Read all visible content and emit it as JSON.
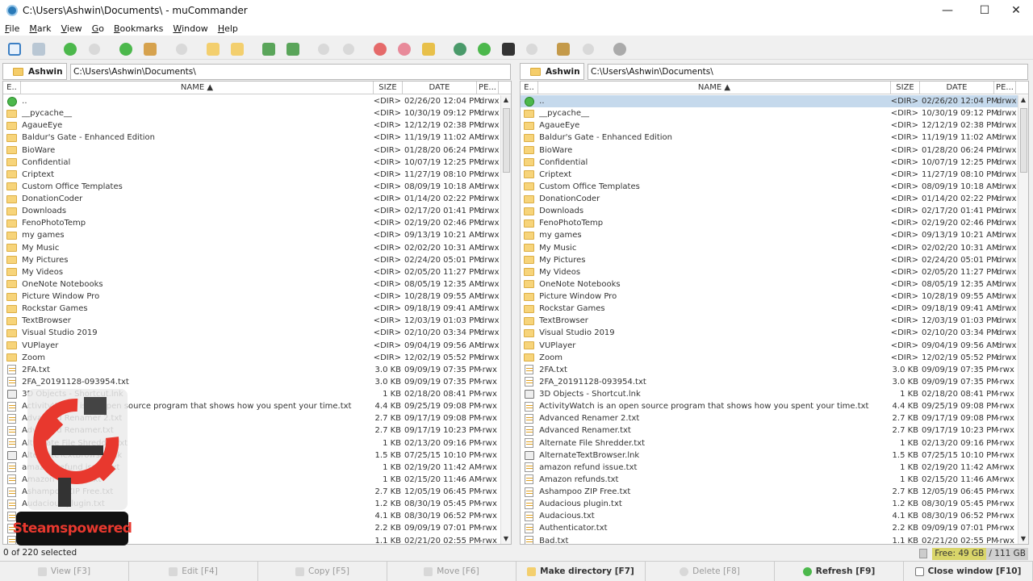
{
  "window": {
    "title": "C:\\Users\\Ashwin\\Documents\\ - muCommander"
  },
  "window_controls": {
    "minimize": "—",
    "maximize": "☐",
    "close": "✕"
  },
  "menu": [
    "File",
    "Mark",
    "View",
    "Go",
    "Bookmarks",
    "Window",
    "Help"
  ],
  "columns": {
    "ext": "E..",
    "name": "NAME ▲",
    "size": "SIZE",
    "date": "DATE",
    "perm": "PE..."
  },
  "left_panel": {
    "drive": "Ashwin",
    "path": "C:\\Users\\Ashwin\\Documents\\"
  },
  "right_panel": {
    "drive": "Ashwin",
    "path": "C:\\Users\\Ashwin\\Documents\\"
  },
  "files_left": [
    {
      "type": "up",
      "name": "..",
      "size": "<DIR>",
      "date": "02/26/20 12:04 PM",
      "perm": "drwx"
    },
    {
      "type": "folder",
      "name": "__pycache__",
      "size": "<DIR>",
      "date": "10/30/19 09:12 PM",
      "perm": "drwx"
    },
    {
      "type": "folder",
      "name": "AgaueEye",
      "size": "<DIR>",
      "date": "12/12/19 02:38 PM",
      "perm": "drwx"
    },
    {
      "type": "folder",
      "name": "Baldur's Gate - Enhanced Edition",
      "size": "<DIR>",
      "date": "11/19/19 11:02 AM",
      "perm": "drwx"
    },
    {
      "type": "folder",
      "name": "BioWare",
      "size": "<DIR>",
      "date": "01/28/20 06:24 PM",
      "perm": "drwx"
    },
    {
      "type": "folder",
      "name": "Confidential",
      "size": "<DIR>",
      "date": "10/07/19 12:25 PM",
      "perm": "drwx"
    },
    {
      "type": "folder",
      "name": "Criptext",
      "size": "<DIR>",
      "date": "11/27/19 08:10 PM",
      "perm": "drwx"
    },
    {
      "type": "folder",
      "name": "Custom Office Templates",
      "size": "<DIR>",
      "date": "08/09/19 10:18 AM",
      "perm": "drwx"
    },
    {
      "type": "folder",
      "name": "DonationCoder",
      "size": "<DIR>",
      "date": "01/14/20 02:22 PM",
      "perm": "drwx"
    },
    {
      "type": "folder",
      "name": "Downloads",
      "size": "<DIR>",
      "date": "02/17/20 01:41 PM",
      "perm": "drwx"
    },
    {
      "type": "folder",
      "name": "FenoPhotoTemp",
      "size": "<DIR>",
      "date": "02/19/20 02:46 PM",
      "perm": "drwx"
    },
    {
      "type": "folder",
      "name": "my games",
      "size": "<DIR>",
      "date": "09/13/19 10:21 AM",
      "perm": "drwx"
    },
    {
      "type": "folder",
      "name": "My Music",
      "size": "<DIR>",
      "date": "02/02/20 10:31 AM",
      "perm": "drwx"
    },
    {
      "type": "folder",
      "name": "My Pictures",
      "size": "<DIR>",
      "date": "02/24/20 05:01 PM",
      "perm": "drwx"
    },
    {
      "type": "folder",
      "name": "My Videos",
      "size": "<DIR>",
      "date": "02/05/20 11:27 PM",
      "perm": "drwx"
    },
    {
      "type": "folder",
      "name": "OneNote Notebooks",
      "size": "<DIR>",
      "date": "08/05/19 12:35 AM",
      "perm": "drwx"
    },
    {
      "type": "folder",
      "name": "Picture Window Pro",
      "size": "<DIR>",
      "date": "10/28/19 09:55 AM",
      "perm": "drwx"
    },
    {
      "type": "folder",
      "name": "Rockstar Games",
      "size": "<DIR>",
      "date": "09/18/19 09:41 AM",
      "perm": "drwx"
    },
    {
      "type": "folder",
      "name": "TextBrowser",
      "size": "<DIR>",
      "date": "12/03/19 01:03 PM",
      "perm": "drwx"
    },
    {
      "type": "folder",
      "name": "Visual Studio 2019",
      "size": "<DIR>",
      "date": "02/10/20 03:34 PM",
      "perm": "drwx"
    },
    {
      "type": "folder",
      "name": "VUPlayer",
      "size": "<DIR>",
      "date": "09/04/19 09:56 AM",
      "perm": "drwx"
    },
    {
      "type": "folder",
      "name": "Zoom",
      "size": "<DIR>",
      "date": "12/02/19 05:52 PM",
      "perm": "drwx"
    },
    {
      "type": "file",
      "name": "2FA.txt",
      "size": "3.0 KB",
      "date": "09/09/19 07:35 PM",
      "perm": "-rwx"
    },
    {
      "type": "file",
      "name": "2FA_20191128-093954.txt",
      "size": "3.0 KB",
      "date": "09/09/19 07:35 PM",
      "perm": "-rwx"
    },
    {
      "type": "link",
      "name": "3D Objects - Shortcut.lnk",
      "size": "1 KB",
      "date": "02/18/20 08:41 PM",
      "perm": "-rwx"
    },
    {
      "type": "file",
      "name": "ActivityWatch is an open source program that shows how you spent your time.txt",
      "size": "4.4 KB",
      "date": "09/25/19 09:08 PM",
      "perm": "-rwx"
    },
    {
      "type": "file",
      "name": "Advanced Renamer 2.txt",
      "size": "2.7 KB",
      "date": "09/17/19 09:08 PM",
      "perm": "-rwx"
    },
    {
      "type": "file",
      "name": "Advanced Renamer.txt",
      "size": "2.7 KB",
      "date": "09/17/19 10:23 PM",
      "perm": "-rwx"
    },
    {
      "type": "file",
      "name": "Alternate File Shredder.txt",
      "size": "1 KB",
      "date": "02/13/20 09:16 PM",
      "perm": "-rwx"
    },
    {
      "type": "link",
      "name": "AlternateTextBrowser.lnk",
      "size": "1.5 KB",
      "date": "07/25/15 10:10 PM",
      "perm": "-rwx"
    },
    {
      "type": "file",
      "name": "amazon refund issue.txt",
      "size": "1 KB",
      "date": "02/19/20 11:42 AM",
      "perm": "-rwx"
    },
    {
      "type": "file",
      "name": "Amazon refunds.txt",
      "size": "1 KB",
      "date": "02/15/20 11:46 AM",
      "perm": "-rwx"
    },
    {
      "type": "file",
      "name": "Ashampoo ZIP Free.txt",
      "size": "2.7 KB",
      "date": "12/05/19 06:45 PM",
      "perm": "-rwx"
    },
    {
      "type": "file",
      "name": "Audacious plugin.txt",
      "size": "1.2 KB",
      "date": "08/30/19 05:45 PM",
      "perm": "-rwx"
    },
    {
      "type": "file",
      "name": "Audacious.txt",
      "size": "4.1 KB",
      "date": "08/30/19 06:52 PM",
      "perm": "-rwx"
    },
    {
      "type": "file",
      "name": "Authenticator.txt",
      "size": "2.2 KB",
      "date": "09/09/19 07:01 PM",
      "perm": "-rwx"
    },
    {
      "type": "file",
      "name": "Bad.txt",
      "size": "1.1 KB",
      "date": "02/21/20 02:55 PM",
      "perm": "-rwx"
    }
  ],
  "files_right": [
    {
      "type": "up",
      "name": "..",
      "size": "<DIR>",
      "date": "02/26/20 12:04 PM",
      "perm": "drwx"
    },
    {
      "type": "folder",
      "name": "__pycache__",
      "size": "<DIR>",
      "date": "10/30/19 09:12 PM",
      "perm": "drwx"
    },
    {
      "type": "folder",
      "name": "AgaueEye",
      "size": "<DIR>",
      "date": "12/12/19 02:38 PM",
      "perm": "drwx"
    },
    {
      "type": "folder",
      "name": "Baldur's Gate - Enhanced Edition",
      "size": "<DIR>",
      "date": "11/19/19 11:02 AM",
      "perm": "drwx"
    },
    {
      "type": "folder",
      "name": "BioWare",
      "size": "<DIR>",
      "date": "01/28/20 06:24 PM",
      "perm": "drwx"
    },
    {
      "type": "folder",
      "name": "Confidential",
      "size": "<DIR>",
      "date": "10/07/19 12:25 PM",
      "perm": "drwx"
    },
    {
      "type": "folder",
      "name": "Criptext",
      "size": "<DIR>",
      "date": "11/27/19 08:10 PM",
      "perm": "drwx"
    },
    {
      "type": "folder",
      "name": "Custom Office Templates",
      "size": "<DIR>",
      "date": "08/09/19 10:18 AM",
      "perm": "drwx"
    },
    {
      "type": "folder",
      "name": "DonationCoder",
      "size": "<DIR>",
      "date": "01/14/20 02:22 PM",
      "perm": "drwx"
    },
    {
      "type": "folder",
      "name": "Downloads",
      "size": "<DIR>",
      "date": "02/17/20 01:41 PM",
      "perm": "drwx"
    },
    {
      "type": "folder",
      "name": "FenoPhotoTemp",
      "size": "<DIR>",
      "date": "02/19/20 02:46 PM",
      "perm": "drwx"
    },
    {
      "type": "folder",
      "name": "my games",
      "size": "<DIR>",
      "date": "09/13/19 10:21 AM",
      "perm": "drwx"
    },
    {
      "type": "folder",
      "name": "My Music",
      "size": "<DIR>",
      "date": "02/02/20 10:31 AM",
      "perm": "drwx"
    },
    {
      "type": "folder",
      "name": "My Pictures",
      "size": "<DIR>",
      "date": "02/24/20 05:01 PM",
      "perm": "drwx"
    },
    {
      "type": "folder",
      "name": "My Videos",
      "size": "<DIR>",
      "date": "02/05/20 11:27 PM",
      "perm": "drwx"
    },
    {
      "type": "folder",
      "name": "OneNote Notebooks",
      "size": "<DIR>",
      "date": "08/05/19 12:35 AM",
      "perm": "drwx"
    },
    {
      "type": "folder",
      "name": "Picture Window Pro",
      "size": "<DIR>",
      "date": "10/28/19 09:55 AM",
      "perm": "drwx"
    },
    {
      "type": "folder",
      "name": "Rockstar Games",
      "size": "<DIR>",
      "date": "09/18/19 09:41 AM",
      "perm": "drwx"
    },
    {
      "type": "folder",
      "name": "TextBrowser",
      "size": "<DIR>",
      "date": "12/03/19 01:03 PM",
      "perm": "drwx"
    },
    {
      "type": "folder",
      "name": "Visual Studio 2019",
      "size": "<DIR>",
      "date": "02/10/20 03:34 PM",
      "perm": "drwx"
    },
    {
      "type": "folder",
      "name": "VUPlayer",
      "size": "<DIR>",
      "date": "09/04/19 09:56 AM",
      "perm": "drwx"
    },
    {
      "type": "folder",
      "name": "Zoom",
      "size": "<DIR>",
      "date": "12/02/19 05:52 PM",
      "perm": "drwx"
    },
    {
      "type": "file",
      "name": "2FA.txt",
      "size": "3.0 KB",
      "date": "09/09/19 07:35 PM",
      "perm": "-rwx"
    },
    {
      "type": "file",
      "name": "2FA_20191128-093954.txt",
      "size": "3.0 KB",
      "date": "09/09/19 07:35 PM",
      "perm": "-rwx"
    },
    {
      "type": "link",
      "name": "3D Objects - Shortcut.lnk",
      "size": "1 KB",
      "date": "02/18/20 08:41 PM",
      "perm": "-rwx"
    },
    {
      "type": "file",
      "name": "ActivityWatch is an open source program that shows how you spent your time.txt",
      "size": "4.4 KB",
      "date": "09/25/19 09:08 PM",
      "perm": "-rwx"
    },
    {
      "type": "file",
      "name": "Advanced Renamer 2.txt",
      "size": "2.7 KB",
      "date": "09/17/19 09:08 PM",
      "perm": "-rwx"
    },
    {
      "type": "file",
      "name": "Advanced Renamer.txt",
      "size": "2.7 KB",
      "date": "09/17/19 10:23 PM",
      "perm": "-rwx"
    },
    {
      "type": "file",
      "name": "Alternate File Shredder.txt",
      "size": "1 KB",
      "date": "02/13/20 09:16 PM",
      "perm": "-rwx"
    },
    {
      "type": "link",
      "name": "AlternateTextBrowser.lnk",
      "size": "1.5 KB",
      "date": "07/25/15 10:10 PM",
      "perm": "-rwx"
    },
    {
      "type": "file",
      "name": "amazon refund issue.txt",
      "size": "1 KB",
      "date": "02/19/20 11:42 AM",
      "perm": "-rwx"
    },
    {
      "type": "file",
      "name": "Amazon refunds.txt",
      "size": "1 KB",
      "date": "02/15/20 11:46 AM",
      "perm": "-rwx"
    },
    {
      "type": "file",
      "name": "Ashampoo ZIP Free.txt",
      "size": "2.7 KB",
      "date": "12/05/19 06:45 PM",
      "perm": "-rwx"
    },
    {
      "type": "file",
      "name": "Audacious plugin.txt",
      "size": "1.2 KB",
      "date": "08/30/19 05:45 PM",
      "perm": "-rwx"
    },
    {
      "type": "file",
      "name": "Audacious.txt",
      "size": "4.1 KB",
      "date": "08/30/19 06:52 PM",
      "perm": "-rwx"
    },
    {
      "type": "file",
      "name": "Authenticator.txt",
      "size": "2.2 KB",
      "date": "09/09/19 07:01 PM",
      "perm": "-rwx"
    },
    {
      "type": "file",
      "name": "Bad.txt",
      "size": "1.1 KB",
      "date": "02/21/20 02:55 PM",
      "perm": "-rwx"
    }
  ],
  "status": {
    "selected": "0 of 220 selected",
    "free": "Free: 49 GB",
    "total": " / 111 GB"
  },
  "function_keys": [
    {
      "label": "View [F3]",
      "enabled": false,
      "icon": "view-icon"
    },
    {
      "label": "Edit [F4]",
      "enabled": false,
      "icon": "edit-icon"
    },
    {
      "label": "Copy [F5]",
      "enabled": false,
      "icon": "copy-icon"
    },
    {
      "label": "Move [F6]",
      "enabled": false,
      "icon": "move-icon"
    },
    {
      "label": "Make directory [F7]",
      "enabled": true,
      "icon": "folder-icon"
    },
    {
      "label": "Delete [F8]",
      "enabled": false,
      "icon": "delete-icon"
    },
    {
      "label": "Refresh [F9]",
      "enabled": true,
      "icon": "refresh-icon"
    },
    {
      "label": "Close window [F10]",
      "enabled": true,
      "icon": "close-window-icon"
    }
  ],
  "watermark": {
    "label": "Steamspowered"
  },
  "colors": {
    "selection": "#c5d9ec",
    "free_bar": "#d9d56a"
  }
}
